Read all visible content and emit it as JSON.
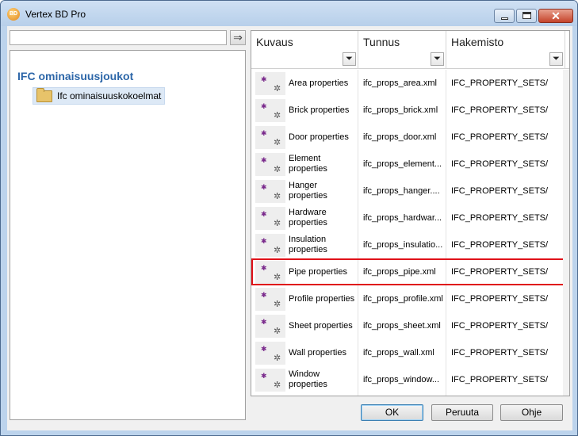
{
  "window": {
    "title": "Vertex BD Pro",
    "icon_text": "BD",
    "close_glyph": "✕"
  },
  "search": {
    "value": "",
    "placeholder": "",
    "go_icon": "⇒"
  },
  "tree": {
    "heading": "IFC ominaisuusjoukot",
    "items": [
      {
        "label": "Ifc ominaisuuskokoelmat",
        "icon": "folder-icon"
      }
    ]
  },
  "grid": {
    "columns": [
      {
        "label": "Kuvaus"
      },
      {
        "label": "Tunnus"
      },
      {
        "label": "Hakemisto"
      }
    ],
    "filter_icon": "⏷",
    "row_icon": {
      "dot": "✱",
      "cog": "✲"
    },
    "rows": [
      {
        "desc": "Area properties",
        "id": "ifc_props_area.xml",
        "dir": "IFC_PROPERTY_SETS/"
      },
      {
        "desc": "Brick properties",
        "id": "ifc_props_brick.xml",
        "dir": "IFC_PROPERTY_SETS/"
      },
      {
        "desc": "Door properties",
        "id": "ifc_props_door.xml",
        "dir": "IFC_PROPERTY_SETS/"
      },
      {
        "desc": "Element properties",
        "id": "ifc_props_element...",
        "dir": "IFC_PROPERTY_SETS/"
      },
      {
        "desc": "Hanger properties",
        "id": "ifc_props_hanger....",
        "dir": "IFC_PROPERTY_SETS/"
      },
      {
        "desc": "Hardware properties",
        "id": "ifc_props_hardwar...",
        "dir": "IFC_PROPERTY_SETS/"
      },
      {
        "desc": "Insulation properties",
        "id": "ifc_props_insulatio...",
        "dir": "IFC_PROPERTY_SETS/"
      },
      {
        "desc": "Pipe properties",
        "id": "ifc_props_pipe.xml",
        "dir": "IFC_PROPERTY_SETS/"
      },
      {
        "desc": "Profile properties",
        "id": "ifc_props_profile.xml",
        "dir": "IFC_PROPERTY_SETS/"
      },
      {
        "desc": "Sheet properties",
        "id": "ifc_props_sheet.xml",
        "dir": "IFC_PROPERTY_SETS/"
      },
      {
        "desc": "Wall properties",
        "id": "ifc_props_wall.xml",
        "dir": "IFC_PROPERTY_SETS/"
      },
      {
        "desc": "Window properties",
        "id": "ifc_props_window...",
        "dir": "IFC_PROPERTY_SETS/"
      }
    ],
    "highlighted_row": 7,
    "highlight_color": "#e0121a"
  },
  "buttons": {
    "ok": "OK",
    "cancel": "Peruuta",
    "help": "Ohje"
  }
}
